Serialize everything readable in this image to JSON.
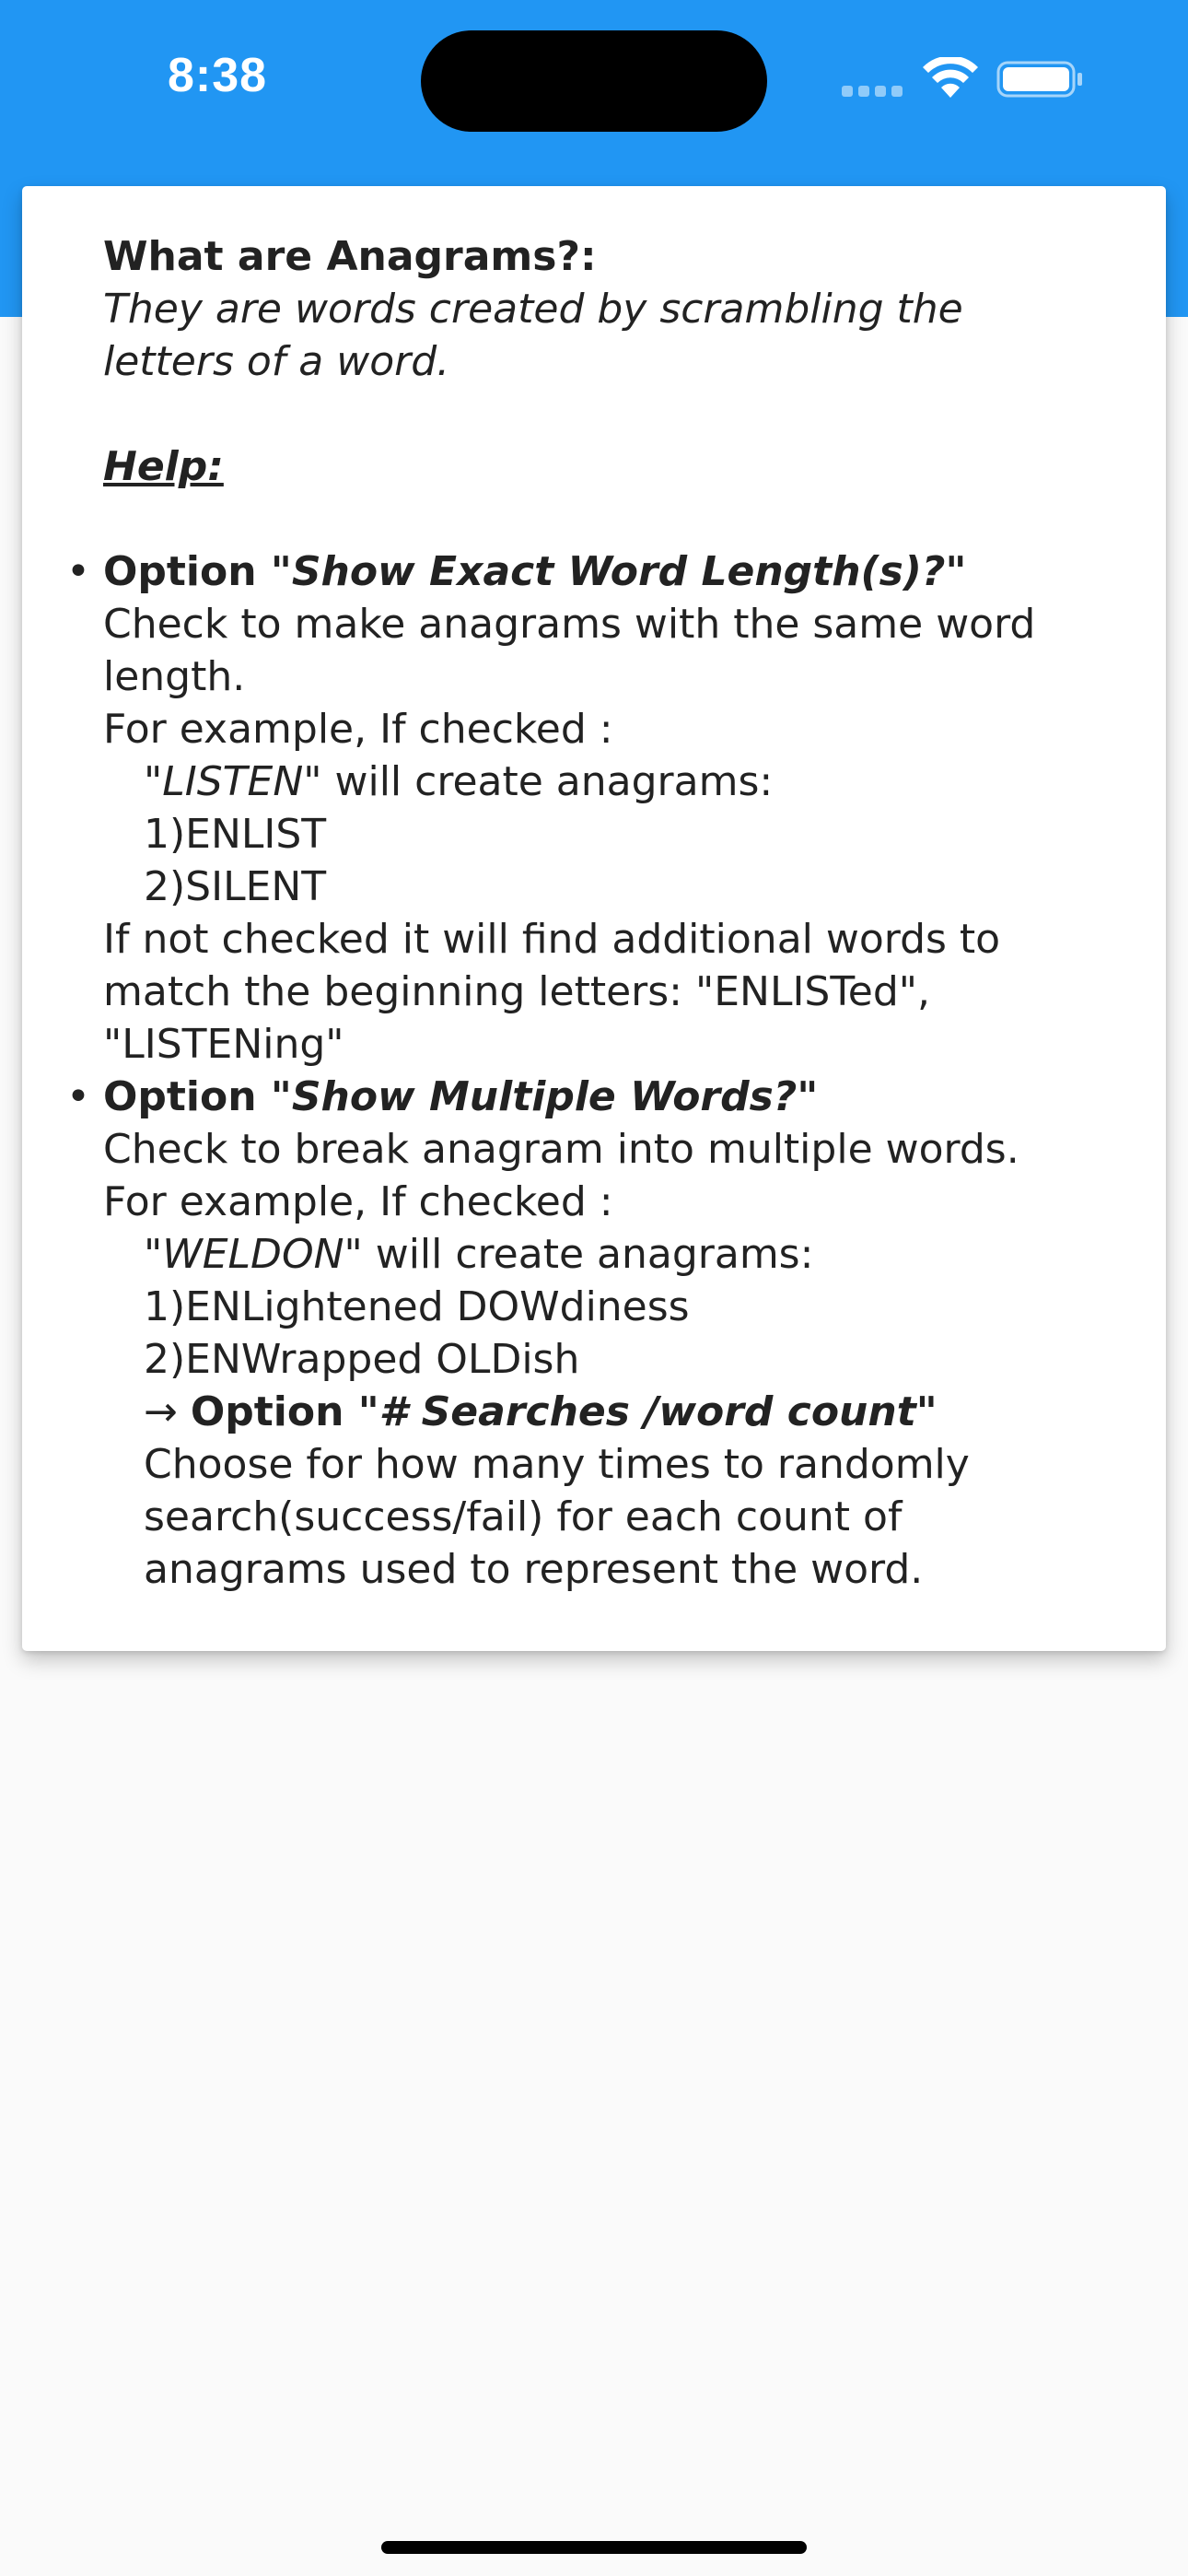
{
  "status_bar": {
    "time": "8:38"
  },
  "colors": {
    "app_bar": "#2196f3",
    "background": "#fafafa",
    "card": "#ffffff",
    "text": "#222222"
  },
  "icons": [
    "wifi-icon",
    "battery-icon",
    "signal-icon"
  ],
  "help": {
    "title": "What are Anagrams?:",
    "definition_line1": "They are words created by scrambling the",
    "definition_line2": "letters of a word.",
    "help_heading": "Help:",
    "option1": {
      "prefix": "Option ",
      "name": "\"Show Exact Word Length(s)?\"",
      "desc_line1": "Check to make anagrams with the same word",
      "desc_line2": "length.",
      "example_intro": "For example, If checked :",
      "example_word": "\"LISTEN\"",
      "example_suffix": " will create anagrams:",
      "result1": "1)ENLIST",
      "result2": "2)SILENT",
      "note_line1": "If not checked it will find additional words to",
      "note_line2": "match the beginning letters: \"ENLISTed\",",
      "note_line3": "\"LISTENing\""
    },
    "option2": {
      "prefix": "Option ",
      "name": "\"Show Multiple Words?\"",
      "desc_line1": "Check to break anagram into multiple words.",
      "example_intro": "For example, If checked :",
      "example_word": "\"WELDON\"",
      "example_suffix": " will create anagrams:",
      "result1": "1)ENLightened DOWdiness",
      "result2": "2)ENWrapped OLDish",
      "sub_arrow": "→ ",
      "sub_prefix": "Option ",
      "sub_name": "\"# Searches /word count\"",
      "sub_desc_line1": "Choose for how many times to randomly",
      "sub_desc_line2": "search(success/fail) for each count of",
      "sub_desc_line3": "anagrams used to represent the word."
    },
    "bullet_glyph": "•"
  }
}
